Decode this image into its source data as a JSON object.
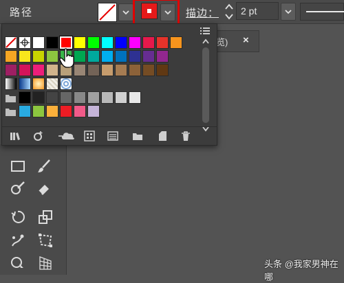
{
  "toolbar": {
    "object_type_label": "路径",
    "fill_icon": "no-fill-swatch",
    "stroke_icon": "stroke-color-swatch",
    "stroke_color": "#e61a1a",
    "stroke_label": "描边：",
    "stroke_weight": "2 pt",
    "highlight_color": "#e10000"
  },
  "document_tab": {
    "label": "览)",
    "close": "×"
  },
  "swatches": {
    "selected_color": "#ff0000",
    "rows": [
      [
        "none",
        "registration",
        "#ffffff",
        "#000000",
        "#ff0000",
        "#ffff00",
        "#00ff00",
        "#00ffff",
        "#0000ff",
        "#ff00ff",
        "#e6194b",
        "#e6332a",
        "#f7941d"
      ],
      [
        "#f6a623",
        "#f8e71c",
        "#c8d400",
        "#8dc63f",
        "#39b54a",
        "#00a651",
        "#00a99d",
        "#00aeef",
        "#0072bc",
        "#2e3192",
        "#662d91",
        "#92278f"
      ],
      [
        "#9e1f63",
        "#d4145a",
        "#ed1e79",
        "#d1b48c",
        "#b8a07a",
        "#998675",
        "#736357",
        "#c69c6d",
        "#a67c52",
        "#8c6239",
        "#754c24",
        "#603813"
      ],
      [
        "gradient-bw",
        "gradient-blue",
        "gradient-orange",
        "pattern-1",
        "pattern-2"
      ],
      [
        "folder",
        "#000000",
        "#222222",
        "#444444",
        "#666666",
        "#888888",
        "#a0a0a0",
        "#b8b8b8",
        "#d0d0d0",
        "#e8e8e8"
      ],
      [
        "folder",
        "#29abe2",
        "#8cc63f",
        "#fbb03b",
        "#ed1c24",
        "#f15a89",
        "#c5b4d8"
      ]
    ]
  },
  "panel_footer": [
    "swatch-libraries-icon",
    "add-to-library-icon",
    "cloud-icon",
    "show-swatch-kinds-icon",
    "swatch-options-icon",
    "new-color-group-icon",
    "new-swatch-icon",
    "delete-swatch-icon"
  ],
  "watermark": "头条 @我家男神在哪"
}
